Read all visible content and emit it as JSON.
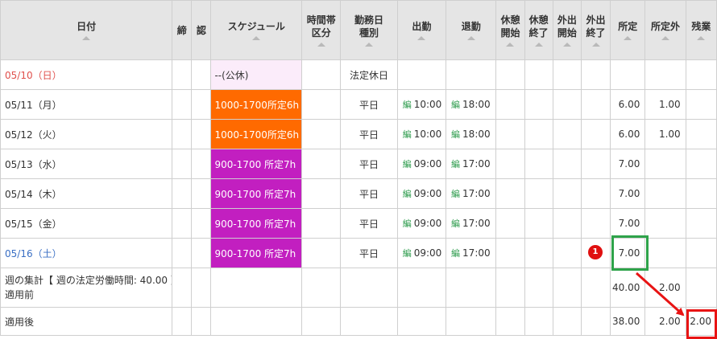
{
  "headers": {
    "date": "日付",
    "close": "締",
    "approve": "認",
    "schedule": "スケジュール",
    "time_zone": [
      "時間帯",
      "区分"
    ],
    "workday_type": [
      "勤務日",
      "種別"
    ],
    "clock_in": "出勤",
    "clock_out": "退勤",
    "break_start": [
      "休憩",
      "開始"
    ],
    "break_end": [
      "休憩",
      "終了"
    ],
    "out_start": [
      "外出",
      "開始"
    ],
    "out_end": [
      "外出",
      "終了"
    ],
    "scheduled": "所定",
    "non_scheduled": "所定外",
    "overtime": "残業"
  },
  "edit_badge": "編",
  "rows": [
    {
      "date": "05/10（日）",
      "schedule": "--(公休)",
      "day_type": "法定休日",
      "in": "",
      "out": "",
      "scheduled": "",
      "non_scheduled": ""
    },
    {
      "date": "05/11（月）",
      "schedule": "1000-1700所定6h",
      "day_type": "平日",
      "in": "10:00",
      "out": "18:00",
      "scheduled": "6.00",
      "non_scheduled": "1.00"
    },
    {
      "date": "05/12（火）",
      "schedule": "1000-1700所定6h",
      "day_type": "平日",
      "in": "10:00",
      "out": "18:00",
      "scheduled": "6.00",
      "non_scheduled": "1.00"
    },
    {
      "date": "05/13（水）",
      "schedule": "900-1700 所定7h",
      "day_type": "平日",
      "in": "09:00",
      "out": "17:00",
      "scheduled": "7.00",
      "non_scheduled": ""
    },
    {
      "date": "05/14（木）",
      "schedule": "900-1700 所定7h",
      "day_type": "平日",
      "in": "09:00",
      "out": "17:00",
      "scheduled": "7.00",
      "non_scheduled": ""
    },
    {
      "date": "05/15（金）",
      "schedule": "900-1700 所定7h",
      "day_type": "平日",
      "in": "09:00",
      "out": "17:00",
      "scheduled": "7.00",
      "non_scheduled": ""
    },
    {
      "date": "05/16（土）",
      "schedule": "900-1700 所定7h",
      "day_type": "平日",
      "in": "09:00",
      "out": "17:00",
      "scheduled": "7.00",
      "non_scheduled": ""
    }
  ],
  "summary": {
    "label_line1": "週の集計【 週の法定労働時間: 40.00 】",
    "label_line2": "適用前",
    "scheduled": "40.00",
    "non_scheduled": "2.00",
    "overtime": ""
  },
  "after": {
    "label": "適用後",
    "scheduled": "38.00",
    "non_scheduled": "2.00",
    "overtime": "2.00"
  },
  "annotation": {
    "badge_number": "1",
    "highlight_color_green": "#2ea34a",
    "highlight_color_red": "#e81414"
  },
  "colors": {
    "holiday_text": "#e0504c",
    "saturday_text": "#3a6fc4",
    "schedule_off": "#fbecfa",
    "schedule_6h": "#ff6a00",
    "schedule_7h": "#c21fc0",
    "edit_badge": "#2a9a4a"
  }
}
